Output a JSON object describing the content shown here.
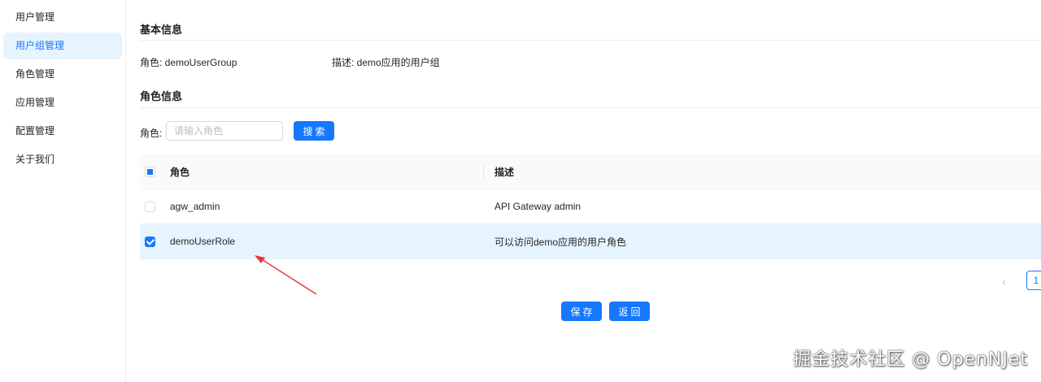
{
  "sidebar": {
    "items": [
      {
        "label": "用户管理"
      },
      {
        "label": "用户组管理"
      },
      {
        "label": "角色管理"
      },
      {
        "label": "应用管理"
      },
      {
        "label": "配置管理"
      },
      {
        "label": "关于我们"
      }
    ],
    "active_index": 1
  },
  "basic_info": {
    "title": "基本信息",
    "role": "角色: demoUserGroup",
    "description": "描述: demo应用的用户组"
  },
  "role_info": {
    "title": "角色信息",
    "search_label": "角色:",
    "search_placeholder": "请输入角色",
    "search_value": "",
    "search_button": "搜索"
  },
  "table": {
    "columns": [
      "角色",
      "描述"
    ],
    "header_checkbox": "indeterminate",
    "rows": [
      {
        "role": "agw_admin",
        "description": "API Gateway admin",
        "checked": false
      },
      {
        "role": "demoUserRole",
        "description": "可以访问demo应用的用户角色",
        "checked": true
      }
    ]
  },
  "pagination": {
    "prev_icon": "chevron-left-icon",
    "current_page": "1"
  },
  "actions": {
    "save_label": "保存",
    "back_label": "返回"
  },
  "annotation": {
    "arrow_color": "#e53935"
  },
  "watermark": "掘金技术社区 @ OpenNJet",
  "colors": {
    "primary": "#1677ff",
    "active_bg": "#e6f4ff"
  }
}
